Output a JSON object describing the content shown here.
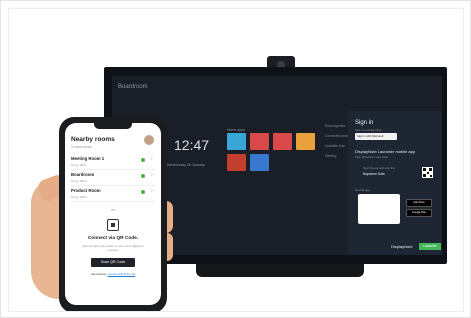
{
  "screen": {
    "room_title": "Boardroom",
    "clock": "12:47",
    "date": "Wednesday 26 January",
    "panel_label": "Home apps",
    "agenda": [
      "Room agenda",
      "Connected devices",
      "Available from",
      "Meeting"
    ],
    "tiles": [
      {
        "color": "#3aa6d8"
      },
      {
        "color": "#d94949"
      },
      {
        "color": "#d94949"
      },
      {
        "color": "#e9a23b"
      },
      {
        "color": "#c33f2d"
      },
      {
        "color": "#3878cf"
      }
    ]
  },
  "signin": {
    "title": "Sign in",
    "subtitle": "Sign in to access more",
    "microsoft_button": "Sign in with Microsoft",
    "launcher_title": "DisplayNote Launcher mobile app",
    "launcher_subtitle": "Scan QR code or enter code",
    "pair_label": "Open the app and scan this",
    "pair_code": "Napolean Suite",
    "get_app": "Get the app",
    "app_store": "App Store",
    "google_play": "Google Play",
    "brand": "DisplayNote",
    "brand_badge": "Launcher"
  },
  "phone": {
    "title": "Nearby rooms",
    "subtitle": "3 rooms found",
    "rooms": [
      {
        "name": "Meeting Room 1",
        "sub": "Room 0001"
      },
      {
        "name": "Boardroom",
        "sub": "Room 0003"
      },
      {
        "name": "Product Room",
        "sub": "Room 0004"
      }
    ],
    "or": "OR",
    "connect_title": "Connect via QR Code.",
    "connect_text": "Scan the QR code shown on your room display to connect.",
    "scan_button": "Scan QR Code",
    "alt_text": "Alternatively,",
    "alt_link": "connect with Room ID"
  }
}
